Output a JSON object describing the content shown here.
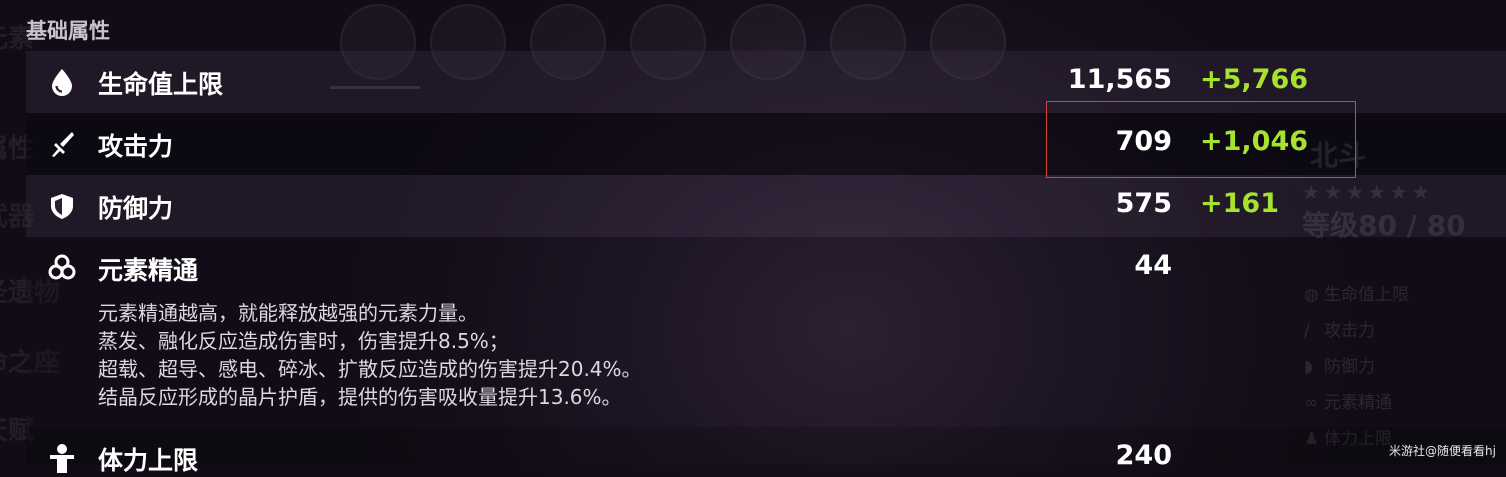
{
  "section_title": "基础属性",
  "stats": [
    {
      "label": "生命值上限",
      "base": "11,565",
      "bonus": "+5,766",
      "icon": "droplet-icon"
    },
    {
      "label": "攻击力",
      "base": "709",
      "bonus": "+1,046",
      "icon": "sword-icon"
    },
    {
      "label": "防御力",
      "base": "575",
      "bonus": "+161",
      "icon": "shield-icon"
    },
    {
      "label": "元素精通",
      "base": "44",
      "bonus": "",
      "icon": "elemental-mastery-icon",
      "description": [
        "元素精通越高，就能释放越强的元素力量。",
        "蒸发、融化反应造成伤害时，伤害提升8.5%；",
        "超载、超导、感电、碎冰、扩散反应造成的伤害提升20.4%。",
        "结晶反应形成的晶片护盾，提供的伤害吸收量提升13.6%。"
      ]
    },
    {
      "label": "体力上限",
      "base": "240",
      "bonus": "",
      "icon": "stamina-icon"
    }
  ],
  "right_panel": {
    "character_name": "北斗",
    "stars": "★★★★★★",
    "level": "等级80 / 80",
    "items": [
      "生命值上限",
      "攻击力",
      "防御力",
      "元素精通",
      "体力上限"
    ]
  },
  "watermark": "米游社@随便看看hj",
  "colors": {
    "bonus": "#a6e22e",
    "highlight": "#d9433f"
  }
}
